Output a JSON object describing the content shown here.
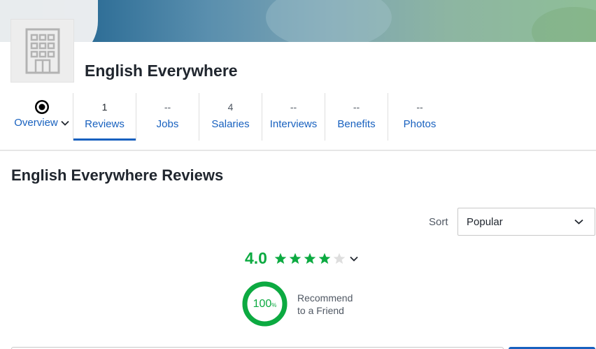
{
  "company": {
    "name": "English Everywhere",
    "logo_icon": "building-icon"
  },
  "tabs": [
    {
      "label": "Overview",
      "count": "",
      "icon": "circle-target-icon",
      "active": false
    },
    {
      "label": "Reviews",
      "count": "1",
      "active": true
    },
    {
      "label": "Jobs",
      "count": "--",
      "active": false
    },
    {
      "label": "Salaries",
      "count": "4",
      "active": false
    },
    {
      "label": "Interviews",
      "count": "--",
      "active": false
    },
    {
      "label": "Benefits",
      "count": "--",
      "active": false
    },
    {
      "label": "Photos",
      "count": "--",
      "active": false
    }
  ],
  "reviews": {
    "title": "English Everywhere Reviews",
    "sort_label": "Sort",
    "sort_value": "Popular",
    "rating": "4.0",
    "rating_value": 4.0,
    "rating_max": 5,
    "recommend_percent": "100",
    "recommend_percent_sign": "%",
    "recommend_fraction": 1.0,
    "recommend_line1": "Recommend",
    "recommend_line2": "to a Friend"
  },
  "colors": {
    "accent": "#1861bf",
    "rating_green": "#0caa41",
    "star_empty": "#dedede"
  }
}
